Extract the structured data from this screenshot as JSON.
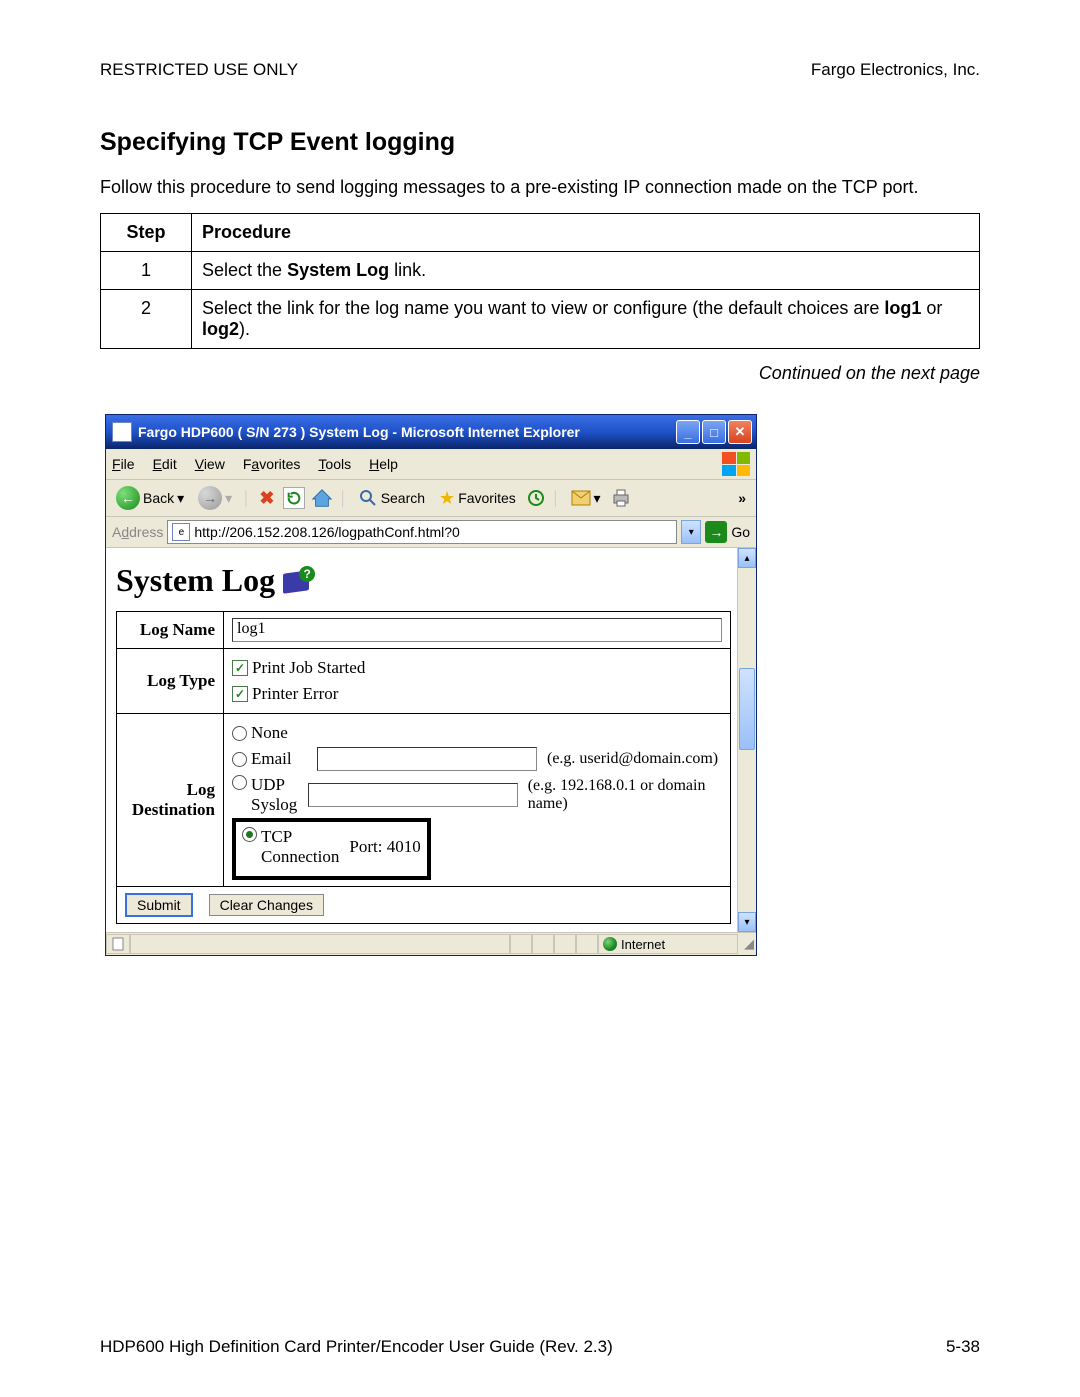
{
  "header": {
    "left": "RESTRICTED USE ONLY",
    "right": "Fargo Electronics, Inc."
  },
  "section_title": "Specifying TCP Event logging",
  "intro": "Follow this procedure to send logging messages to a pre-existing IP connection made on the TCP port.",
  "table": {
    "head_step": "Step",
    "head_proc": "Procedure",
    "rows": [
      {
        "num": "1",
        "pre": "Select the ",
        "bold": "System Log",
        "post": " link."
      },
      {
        "num": "2",
        "pre": "Select the link for the log name you want to view or configure (the default choices are ",
        "bold": "log1",
        "mid": " or ",
        "bold2": "log2",
        "post": ")."
      }
    ]
  },
  "continued": "Continued on the next page",
  "ie": {
    "title": "Fargo HDP600 ( S/N 273 ) System Log - Microsoft Internet Explorer",
    "menus": {
      "file": "File",
      "edit": "Edit",
      "view": "View",
      "favorites": "Favorites",
      "tools": "Tools",
      "help": "Help"
    },
    "toolbar": {
      "back": "Back",
      "search": "Search",
      "favorites": "Favorites",
      "overflow": "»"
    },
    "address_label": "Address",
    "address_value": "http://206.152.208.126/logpathConf.html?0",
    "go": "Go",
    "page_heading": "System Log",
    "form": {
      "log_name_label": "Log Name",
      "log_name_value": "log1",
      "log_type_label": "Log Type",
      "log_type_opts": {
        "print_job": "Print Job Started",
        "printer_error": "Printer Error"
      },
      "log_dest_label": "Log Destination",
      "dest": {
        "none": "None",
        "email": "Email",
        "email_hint": "(e.g. userid@domain.com)",
        "udp": "UDP Syslog",
        "udp_hint": "(e.g. 192.168.0.1 or domain name)",
        "tcp": "TCP Connection",
        "port_label": "Port: 4010"
      },
      "submit": "Submit",
      "clear": "Clear Changes"
    },
    "status_zone": "Internet"
  },
  "footer": {
    "left": "HDP600 High Definition Card Printer/Encoder User Guide (Rev. 2.3)",
    "right": "5-38"
  }
}
